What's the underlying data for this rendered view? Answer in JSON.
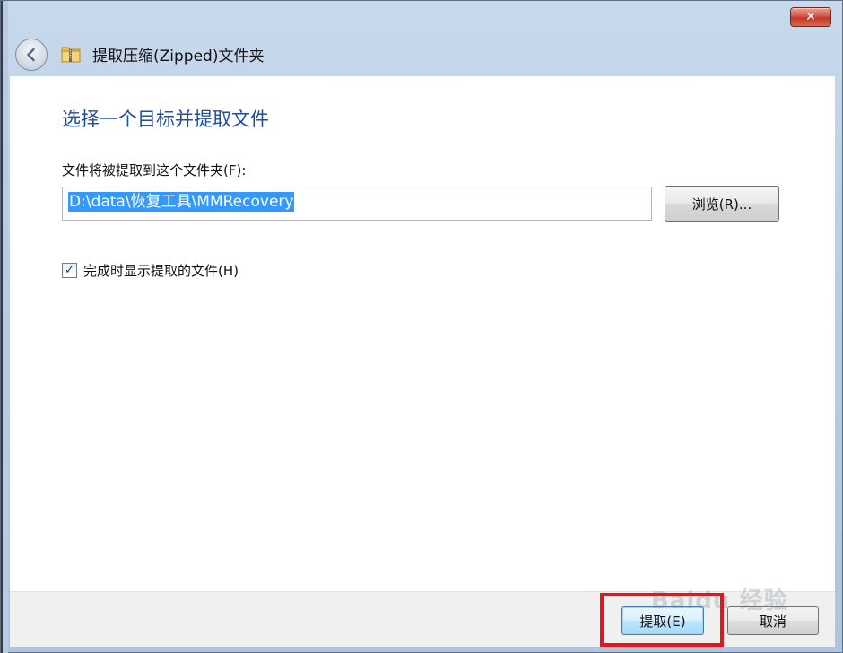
{
  "window": {
    "title": "提取压缩(Zipped)文件夹",
    "close_symbol": "✕"
  },
  "icons": {
    "back": "back-arrow-icon",
    "folder": "zipped-folder-icon",
    "close": "close-icon",
    "check": "checkmark-icon"
  },
  "main": {
    "heading": "选择一个目标并提取文件",
    "path_label": "文件将被提取到这个文件夹(F):",
    "path_value": "D:\\data\\恢复工具\\MMRecovery",
    "browse_label": "浏览(R)...",
    "show_files_label": "完成时显示提取的文件(H)",
    "show_files_checked": true,
    "check_mark": "✓"
  },
  "footer": {
    "extract_label": "提取(E)",
    "cancel_label": "取消"
  },
  "watermark": {
    "text": "Baidu 经验"
  },
  "colors": {
    "heading": "#1e4fa5",
    "selection": "#3399ff",
    "highlight": "#e3161c"
  }
}
